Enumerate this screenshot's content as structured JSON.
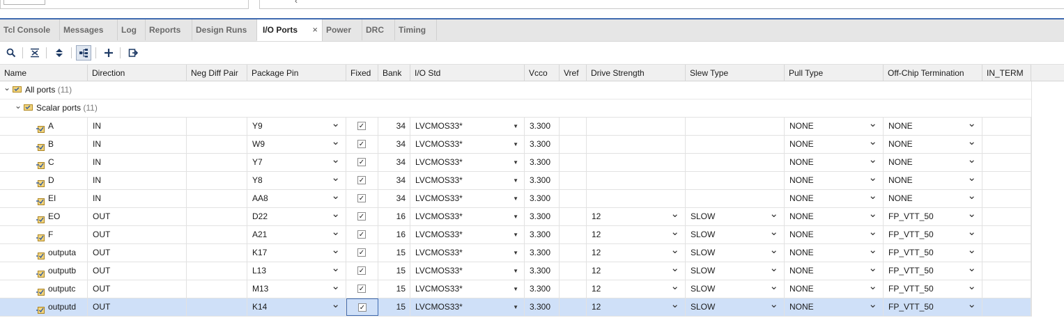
{
  "tabs": [
    {
      "label": "Tcl Console",
      "active": false
    },
    {
      "label": "Messages",
      "active": false
    },
    {
      "label": "Log",
      "active": false
    },
    {
      "label": "Reports",
      "active": false
    },
    {
      "label": "Design Runs",
      "active": false
    },
    {
      "label": "I/O Ports",
      "active": true
    },
    {
      "label": "Power",
      "active": false
    },
    {
      "label": "DRC",
      "active": false
    },
    {
      "label": "Timing",
      "active": false
    }
  ],
  "toolbar": {
    "icons": [
      "search-icon",
      "collapse-all-icon",
      "expand-all-icon",
      "group-by-interface-icon",
      "add-icon",
      "export-icon"
    ]
  },
  "columns": [
    "Name",
    "Direction",
    "Neg Diff Pair",
    "Package Pin",
    "Fixed",
    "Bank",
    "I/O Std",
    "Vcco",
    "Vref",
    "Drive Strength",
    "Slew Type",
    "Pull Type",
    "Off-Chip Termination",
    "IN_TERM"
  ],
  "tree": {
    "all_ports_label": "All ports",
    "all_ports_count": "(11)",
    "scalar_ports_label": "Scalar ports",
    "scalar_ports_count": "(11)"
  },
  "ports": [
    {
      "name": "A",
      "direction": "IN",
      "neg_diff_pair": "",
      "package_pin": "Y9",
      "fixed": true,
      "bank": "34",
      "io_std": "LVCMOS33*",
      "vcco": "3.300",
      "vref": "",
      "drive_strength": "",
      "slew_type": "",
      "pull_type": "NONE",
      "off_chip_termination": "NONE",
      "in_term": ""
    },
    {
      "name": "B",
      "direction": "IN",
      "neg_diff_pair": "",
      "package_pin": "W9",
      "fixed": true,
      "bank": "34",
      "io_std": "LVCMOS33*",
      "vcco": "3.300",
      "vref": "",
      "drive_strength": "",
      "slew_type": "",
      "pull_type": "NONE",
      "off_chip_termination": "NONE",
      "in_term": ""
    },
    {
      "name": "C",
      "direction": "IN",
      "neg_diff_pair": "",
      "package_pin": "Y7",
      "fixed": true,
      "bank": "34",
      "io_std": "LVCMOS33*",
      "vcco": "3.300",
      "vref": "",
      "drive_strength": "",
      "slew_type": "",
      "pull_type": "NONE",
      "off_chip_termination": "NONE",
      "in_term": ""
    },
    {
      "name": "D",
      "direction": "IN",
      "neg_diff_pair": "",
      "package_pin": "Y8",
      "fixed": true,
      "bank": "34",
      "io_std": "LVCMOS33*",
      "vcco": "3.300",
      "vref": "",
      "drive_strength": "",
      "slew_type": "",
      "pull_type": "NONE",
      "off_chip_termination": "NONE",
      "in_term": ""
    },
    {
      "name": "EI",
      "direction": "IN",
      "neg_diff_pair": "",
      "package_pin": "AA8",
      "fixed": true,
      "bank": "34",
      "io_std": "LVCMOS33*",
      "vcco": "3.300",
      "vref": "",
      "drive_strength": "",
      "slew_type": "",
      "pull_type": "NONE",
      "off_chip_termination": "NONE",
      "in_term": ""
    },
    {
      "name": "EO",
      "direction": "OUT",
      "neg_diff_pair": "",
      "package_pin": "D22",
      "fixed": true,
      "bank": "16",
      "io_std": "LVCMOS33*",
      "vcco": "3.300",
      "vref": "",
      "drive_strength": "12",
      "slew_type": "SLOW",
      "pull_type": "NONE",
      "off_chip_termination": "FP_VTT_50",
      "in_term": ""
    },
    {
      "name": "F",
      "direction": "OUT",
      "neg_diff_pair": "",
      "package_pin": "A21",
      "fixed": true,
      "bank": "16",
      "io_std": "LVCMOS33*",
      "vcco": "3.300",
      "vref": "",
      "drive_strength": "12",
      "slew_type": "SLOW",
      "pull_type": "NONE",
      "off_chip_termination": "FP_VTT_50",
      "in_term": ""
    },
    {
      "name": "outputa",
      "direction": "OUT",
      "neg_diff_pair": "",
      "package_pin": "K17",
      "fixed": true,
      "bank": "15",
      "io_std": "LVCMOS33*",
      "vcco": "3.300",
      "vref": "",
      "drive_strength": "12",
      "slew_type": "SLOW",
      "pull_type": "NONE",
      "off_chip_termination": "FP_VTT_50",
      "in_term": ""
    },
    {
      "name": "outputb",
      "direction": "OUT",
      "neg_diff_pair": "",
      "package_pin": "L13",
      "fixed": true,
      "bank": "15",
      "io_std": "LVCMOS33*",
      "vcco": "3.300",
      "vref": "",
      "drive_strength": "12",
      "slew_type": "SLOW",
      "pull_type": "NONE",
      "off_chip_termination": "FP_VTT_50",
      "in_term": ""
    },
    {
      "name": "outputc",
      "direction": "OUT",
      "neg_diff_pair": "",
      "package_pin": "M13",
      "fixed": true,
      "bank": "15",
      "io_std": "LVCMOS33*",
      "vcco": "3.300",
      "vref": "",
      "drive_strength": "12",
      "slew_type": "SLOW",
      "pull_type": "NONE",
      "off_chip_termination": "FP_VTT_50",
      "in_term": ""
    },
    {
      "name": "outputd",
      "direction": "OUT",
      "neg_diff_pair": "",
      "package_pin": "K14",
      "fixed": true,
      "bank": "15",
      "io_std": "LVCMOS33*",
      "vcco": "3.300",
      "vref": "",
      "drive_strength": "12",
      "slew_type": "SLOW",
      "pull_type": "NONE",
      "off_chip_termination": "FP_VTT_50",
      "in_term": "",
      "selected": true
    }
  ],
  "colors": {
    "accent": "#3f6ab0",
    "selected_row": "#cfe0f8",
    "tabbar": "#e6e6e6"
  }
}
